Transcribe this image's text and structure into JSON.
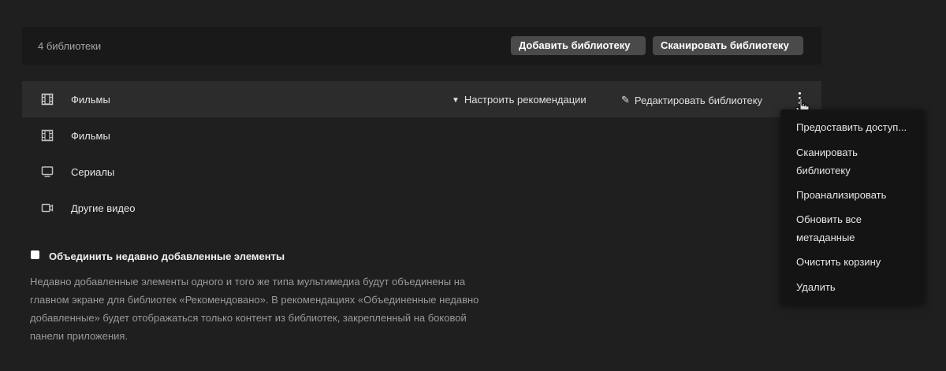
{
  "header": {
    "library_count": "4 библиотеки",
    "add_library_label": "Добавить библиотеку",
    "scan_library_label": "Сканировать библиотеку"
  },
  "libraries": [
    {
      "name": "Фильмы",
      "icon": "film-icon"
    },
    {
      "name": "Фильмы",
      "icon": "film-icon"
    },
    {
      "name": "Сериалы",
      "icon": "tv-icon"
    },
    {
      "name": "Другие видео",
      "icon": "video-camera-icon"
    }
  ],
  "row_actions": {
    "recommend_label": "Настроить рекомендации",
    "edit_label": "Редактировать библиотеку"
  },
  "menu": {
    "items": [
      "Предоставить доступ...",
      "Сканировать библиотеку",
      "Проанализировать",
      "Обновить все метаданные",
      "Очистить корзину",
      "Удалить"
    ]
  },
  "combine": {
    "label": "Объединить недавно добавленные элементы",
    "checked": false,
    "description": [
      "Недавно добавленные элементы одного и того же типа мультимедиа будут объединены на",
      "главном экране для библиотек «Рекомендовано». В рекомендациях «Объединенные недавно",
      "добавленные» будет отображаться только контент из библиотек, закрепленный на боковой",
      "панели приложения."
    ]
  }
}
